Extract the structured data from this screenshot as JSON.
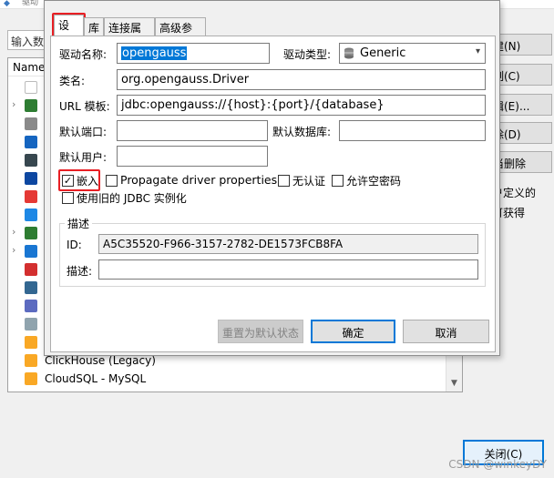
{
  "bg": {
    "title": "驱动",
    "search_placeholder": "输入数",
    "list_header": "Name",
    "rows": [
      {
        "label": "",
        "icon_color": "#ffffff",
        "chev": "",
        "icon": "db-outline-icon"
      },
      {
        "label": "",
        "icon_color": "#2e7d32",
        "chev": "›",
        "icon": "db-green-icon"
      },
      {
        "label": "",
        "icon_color": "#8a8a8a",
        "chev": "",
        "icon": "db-gray-icon"
      },
      {
        "label": "",
        "icon_color": "#1565c0",
        "chev": "",
        "icon": "a-blue-icon"
      },
      {
        "label": "",
        "icon_color": "#37474f",
        "chev": "",
        "icon": "chevrons-icon"
      },
      {
        "label": "",
        "icon_color": "#0d47a1",
        "chev": "",
        "icon": "bird-icon"
      },
      {
        "label": "",
        "icon_color": "#e53935",
        "chev": "",
        "icon": "flame-icon"
      },
      {
        "label": "",
        "icon_color": "#1e88e5",
        "chev": "",
        "icon": "feather-icon"
      },
      {
        "label": "",
        "icon_color": "#2e7d32",
        "chev": "›",
        "icon": "db-green-icon"
      },
      {
        "label": "",
        "icon_color": "#1976d2",
        "chev": "›",
        "icon": "triangle-icon"
      },
      {
        "label": "",
        "icon_color": "#d32f2f",
        "chev": "",
        "icon": "layers-icon"
      },
      {
        "label": "",
        "icon_color": "#336791",
        "chev": "",
        "icon": "elephant-icon"
      },
      {
        "label": "",
        "icon_color": "#5c6bc0",
        "chev": "",
        "icon": "drop-icon"
      },
      {
        "label": "",
        "icon_color": "#90a4ae",
        "chev": "",
        "icon": "leaf-icon"
      },
      {
        "label": "",
        "icon_color": "#f9a825",
        "chev": "",
        "icon": "bars-icon"
      },
      {
        "label": "ClickHouse (Legacy)",
        "icon_color": "#f9a825",
        "chev": "",
        "icon": "clickhouse-icon"
      },
      {
        "label": "CloudSQL - MySQL",
        "icon_color": "#f9a825",
        "chev": "",
        "icon": "cloudsql-icon"
      }
    ],
    "buttons": [
      "建(N)",
      "制(C)",
      "辑(E)...",
      "除(D)",
      "当删除"
    ],
    "side_text": [
      "户定义的",
      "可获得"
    ],
    "close": "关闭(C)",
    "watermark": "CSDN @winkeyDY"
  },
  "dialog": {
    "tabs": [
      "设置",
      "库",
      "连接属性",
      "高级参数"
    ],
    "fields": {
      "driver_name_label": "驱动名称:",
      "driver_name_value": "opengauss",
      "driver_type_label": "驱动类型:",
      "driver_type_value": "Generic",
      "class_label": "类名:",
      "class_value": "org.opengauss.Driver",
      "url_label": "URL 模板:",
      "url_value": "jdbc:opengauss://{host}:{port}/{database}",
      "default_port_label": "默认端口:",
      "default_port_value": "",
      "default_db_label": "默认数据库:",
      "default_db_value": "",
      "default_user_label": "默认用户:",
      "default_user_value": ""
    },
    "checks": {
      "embed": "嵌入",
      "propagate": "Propagate driver properties",
      "no_auth": "无认证",
      "allow_empty_pw": "允许空密码",
      "legacy_jdbc": "使用旧的 JDBC 实例化"
    },
    "check_states": {
      "embed": true,
      "propagate": false,
      "no_auth": false,
      "allow_empty_pw": false,
      "legacy_jdbc": false
    },
    "desc": {
      "group_label": "描述",
      "id_label": "ID:",
      "id_value": "A5C35520-F966-3157-2782-DE1573FCB8FA",
      "desc_label": "描述:",
      "desc_value": ""
    },
    "buttons": {
      "reset": "重置为默认状态",
      "ok": "确定",
      "cancel": "取消"
    },
    "highlight_color": "#e81f24"
  }
}
